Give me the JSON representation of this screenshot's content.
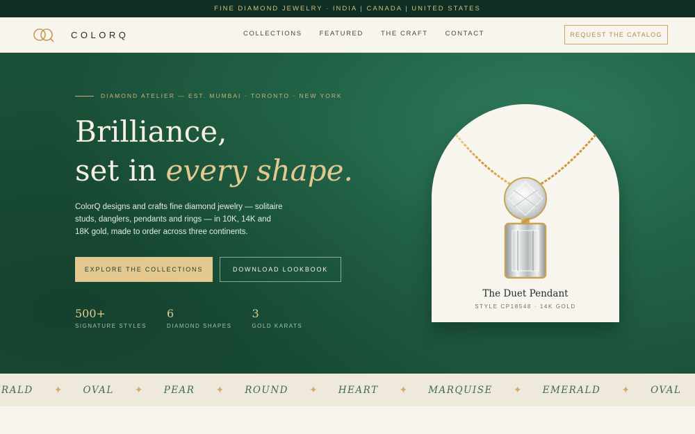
{
  "topbar": {
    "text": "FINE DIAMOND JEWELRY · INDIA | CANADA | UNITED STATES"
  },
  "brand": {
    "name": "COLORQ"
  },
  "nav": {
    "links": [
      "COLLECTIONS",
      "FEATURED",
      "THE CRAFT",
      "CONTACT"
    ],
    "cta": "REQUEST THE CATALOG"
  },
  "hero": {
    "eyebrow": "DIAMOND ATELIER — EST. MUMBAI · TORONTO · NEW YORK",
    "headline_line1": "Brilliance,",
    "headline_line2_plain": "set in ",
    "headline_line2_italic": "every shape.",
    "lead": "ColorQ designs and crafts fine diamond jewelry — solitaire studs, danglers, pendants and rings — in 10K, 14K and 18K gold, made to order across three continents.",
    "primary_cta": "EXPLORE THE COLLECTIONS",
    "secondary_cta": "DOWNLOAD LOOKBOOK",
    "stats": [
      {
        "value": "500+",
        "label": "SIGNATURE STYLES"
      },
      {
        "value": "6",
        "label": "DIAMOND SHAPES"
      },
      {
        "value": "3",
        "label": "GOLD KARATS"
      }
    ]
  },
  "featured": {
    "title": "The Duet Pendant",
    "subtitle": "STYLE CP18548 · 14K GOLD"
  },
  "marquee": {
    "shapes": [
      "EMERALD",
      "OVAL",
      "PEAR",
      "ROUND",
      "HEART",
      "MARQUISE",
      "EMERALD",
      "OVAL"
    ],
    "separator": "✦"
  },
  "colors": {
    "topbar_bg": "#0f2e24",
    "hero_green": "#226448",
    "gold": "#e3c98f",
    "cream": "#f8f5ee"
  }
}
